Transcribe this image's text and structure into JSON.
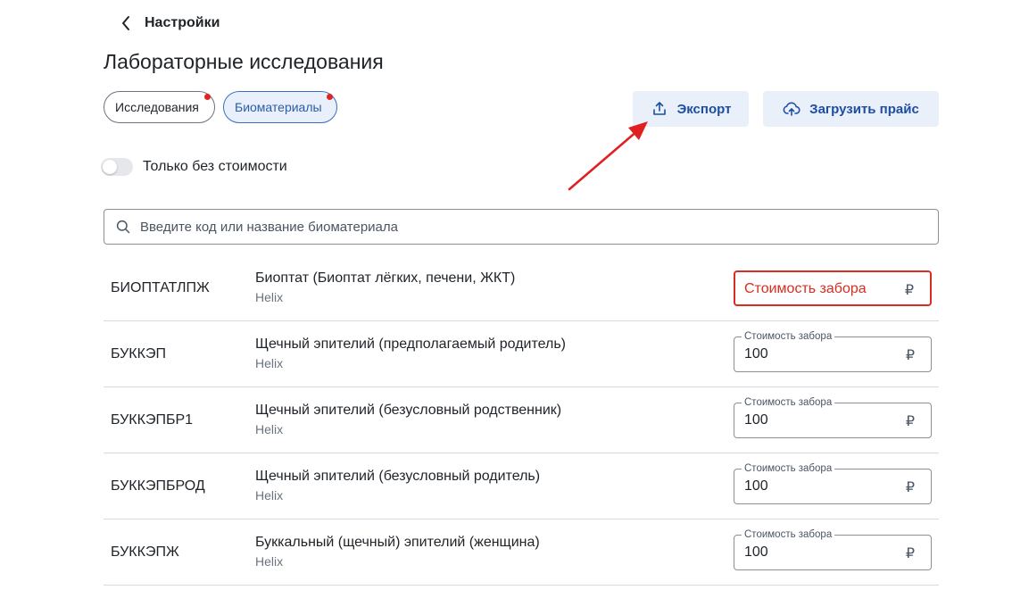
{
  "header": {
    "back_label": "Настройки",
    "title": "Лабораторные исследования"
  },
  "tabs": [
    {
      "label": "Исследования",
      "active": false,
      "has_dot": true
    },
    {
      "label": "Биоматериалы",
      "active": true,
      "has_dot": true
    }
  ],
  "toolbar": {
    "export_label": "Экспорт",
    "export_icon": "upload-icon",
    "upload_price_label": "Загрузить прайс",
    "upload_price_icon": "cloud-upload-icon"
  },
  "filter": {
    "only_without_price_label": "Только без стоимости",
    "only_without_price_enabled": false
  },
  "search": {
    "placeholder": "Введите код или название биоматериала",
    "value": ""
  },
  "price_field_label": "Стоимость забора",
  "currency_symbol": "₽",
  "items": [
    {
      "code": "БИОПТАТЛПЖ",
      "name": "Биоптат (Биоптат лёгких, печени, ЖКТ)",
      "provider": "Helix",
      "price": "",
      "error": true
    },
    {
      "code": "БУККЭП",
      "name": "Щечный эпителий (предполагаемый родитель)",
      "provider": "Helix",
      "price": "100",
      "error": false
    },
    {
      "code": "БУККЭПБР1",
      "name": "Щечный эпителий (безусловный родственник)",
      "provider": "Helix",
      "price": "100",
      "error": false
    },
    {
      "code": "БУККЭПБРОД",
      "name": "Щечный эпителий (безусловный родитель)",
      "provider": "Helix",
      "price": "100",
      "error": false
    },
    {
      "code": "БУККЭПЖ",
      "name": "Буккальный (щечный) эпителий (женщина)",
      "provider": "Helix",
      "price": "100",
      "error": false
    }
  ],
  "colors": {
    "accent": "#1d4ea3",
    "button_bg": "#eaf0f9",
    "error": "#d92d20",
    "annotation_arrow": "#e02020"
  }
}
